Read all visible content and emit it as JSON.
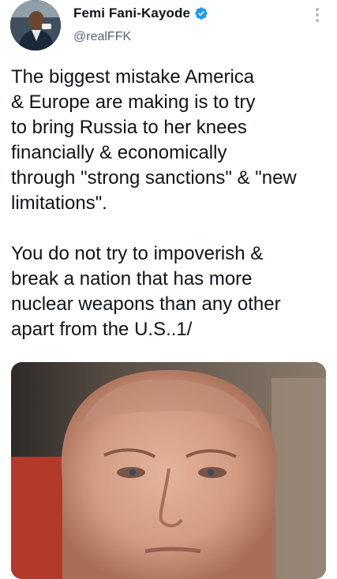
{
  "tweet": {
    "display_name": "Femi Fani-Kayode",
    "handle": "@realFFK",
    "text": "The biggest mistake America\n& Europe are making is to try\nto bring Russia to her knees\nfinancially & economically\nthrough \"strong sanctions\" & \"new\nlimitations\".\n\nYou do not try to impoverish &\nbreak a nation that has more\nnuclear weapons than any other\napart from the U.S..1/"
  },
  "icons": {
    "verified": "verified-badge-icon",
    "more": "more-options-icon"
  },
  "colors": {
    "verified_blue": "#1d9bf0",
    "handle_gray": "#536471",
    "text": "#0f1419"
  }
}
